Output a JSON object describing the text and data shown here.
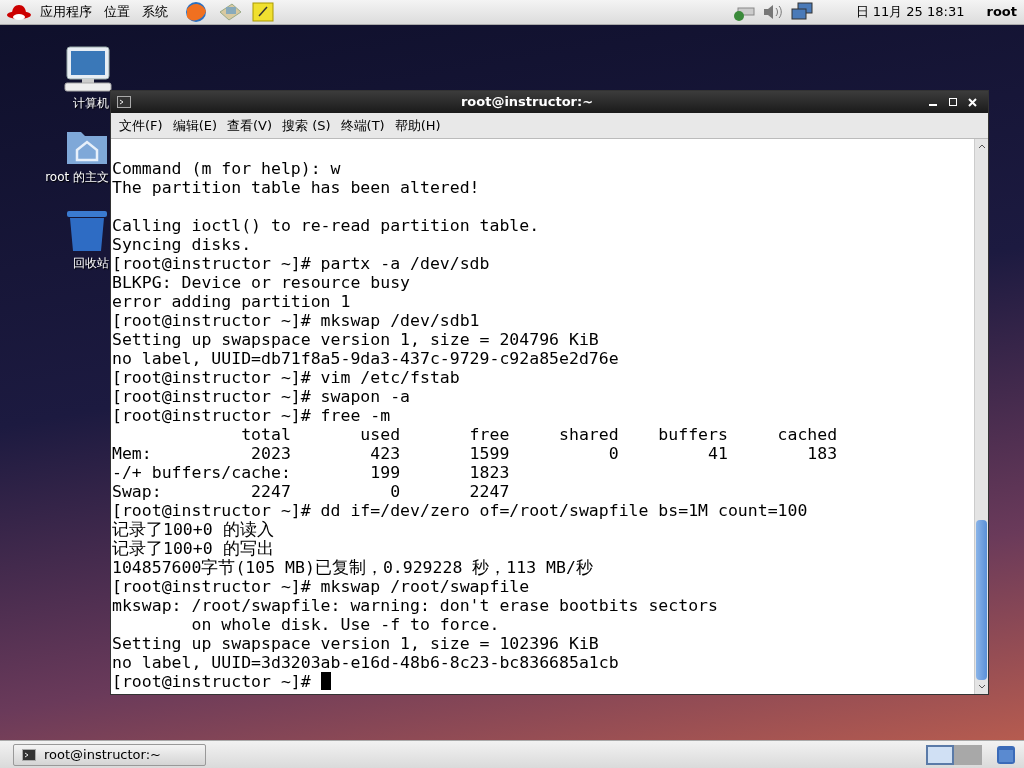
{
  "top_panel": {
    "menus": [
      "应用程序",
      "位置",
      "系统"
    ],
    "clock": "日 11月 25 18:31",
    "user": "root"
  },
  "desktop_icons": [
    {
      "kind": "computer",
      "label": "计算机"
    },
    {
      "kind": "home",
      "label": "root 的主文"
    },
    {
      "kind": "trash",
      "label": "回收站"
    }
  ],
  "window": {
    "title": "root@instructor:~",
    "menu": [
      "文件(F)",
      "编辑(E)",
      "查看(V)",
      "搜索 (S)",
      "终端(T)",
      "帮助(H)"
    ],
    "blocks": [
      [
        "Command (m for help): w",
        "The partition table has been altered!"
      ],
      [
        "Calling ioctl() to re-read partition table.",
        "Syncing disks.",
        "[root@instructor ~]# partx -a /dev/sdb",
        "BLKPG: Device or resource busy",
        "error adding partition 1",
        "[root@instructor ~]# mkswap /dev/sdb1",
        "Setting up swapspace version 1, size = 204796 KiB",
        "no label, UUID=db71f8a5-9da3-437c-9729-c92a85e2d76e",
        "[root@instructor ~]# vim /etc/fstab",
        "[root@instructor ~]# swapon -a",
        "[root@instructor ~]# free -m",
        "             total       used       free     shared    buffers     cached",
        "Mem:          2023        423       1599          0         41        183",
        "-/+ buffers/cache:        199       1823",
        "Swap:         2247          0       2247",
        "[root@instructor ~]# dd if=/dev/zero of=/root/swapfile bs=1M count=100",
        "记录了100+0 的读入",
        "记录了100+0 的写出",
        "104857600字节(105 MB)已复制，0.929228 秒，113 MB/秒",
        "[root@instructor ~]# mkswap /root/swapfile",
        "mkswap: /root/swapfile: warning: don't erase bootbits sectors",
        "        on whole disk. Use -f to force.",
        "Setting up swapspace version 1, size = 102396 KiB",
        "no label, UUID=3d3203ab-e16d-48b6-8c23-bc836685a1cb",
        "[root@instructor ~]# "
      ]
    ]
  },
  "taskbar": {
    "tasks": [
      {
        "label": "root@instructor:~",
        "selected": false
      }
    ],
    "workspaces": [
      {
        "selected": true
      },
      {
        "selected": false
      }
    ]
  }
}
